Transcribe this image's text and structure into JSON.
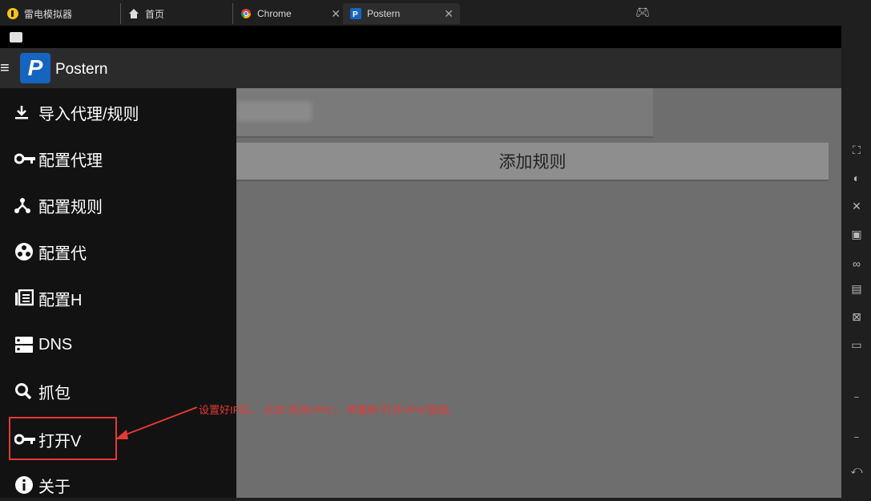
{
  "tabs": [
    {
      "label": "雷电模拟器",
      "icon": "leidian-logo-icon"
    },
    {
      "label": "首页",
      "icon": "home-icon"
    },
    {
      "label": "Chrome",
      "icon": "chrome-icon"
    },
    {
      "label": "Postern",
      "icon": "postern-icon"
    }
  ],
  "app": {
    "title": "Postern",
    "logo_letter": "P"
  },
  "main": {
    "add_rule_label": "添加规则"
  },
  "drawer": {
    "items": [
      {
        "label": "导入代理/规则",
        "icon": "download-icon"
      },
      {
        "label": "配置代理",
        "icon": "key-icon"
      },
      {
        "label": "配置规则",
        "icon": "fork-icon"
      },
      {
        "label": "配置代",
        "icon": "proxy-group-icon"
      },
      {
        "label": "配置H",
        "icon": "list-icon"
      },
      {
        "label": "DNS",
        "icon": "dns-icon"
      },
      {
        "label": "抓包",
        "icon": "search-icon"
      },
      {
        "label": "打开V",
        "icon": "key-icon"
      },
      {
        "label": "关于",
        "icon": "info-icon"
      }
    ]
  },
  "annotation": {
    "text": "设置好IP后， 点击“关闭VPN”， 再重新“打开VPN”按钮。",
    "color": "#e53935"
  },
  "colors": {
    "accent": "#1565c0",
    "highlight": "#e53935"
  }
}
